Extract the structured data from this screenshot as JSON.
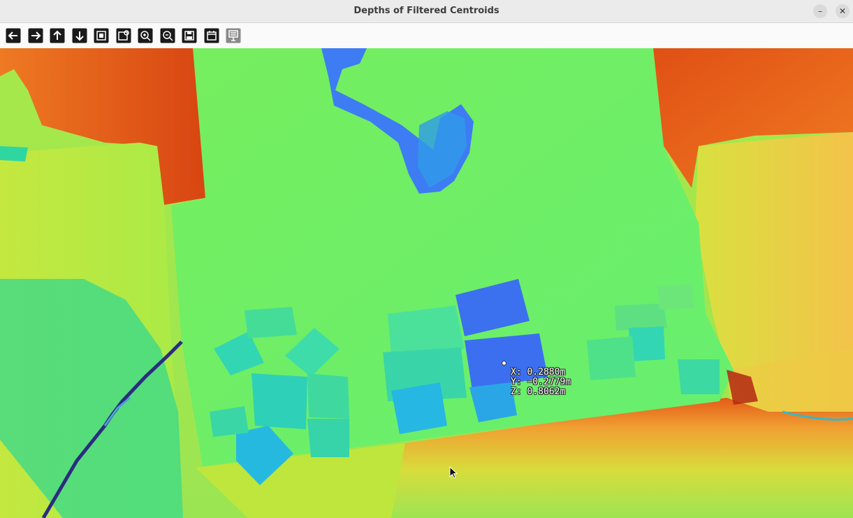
{
  "window": {
    "title": "Depths of Filtered Centroids",
    "minimize_label": "–",
    "close_label": "✕"
  },
  "toolbar": {
    "buttons": [
      {
        "name": "pan-left-button",
        "icon": "arrow-left-icon"
      },
      {
        "name": "pan-right-button",
        "icon": "arrow-right-icon"
      },
      {
        "name": "pan-up-button",
        "icon": "arrow-up-icon"
      },
      {
        "name": "pan-down-button",
        "icon": "arrow-down-icon"
      },
      {
        "name": "zoom-fit-button",
        "icon": "fit-image-icon"
      },
      {
        "name": "zoom-actual-button",
        "icon": "actual-size-icon"
      },
      {
        "name": "zoom-in-button",
        "icon": "zoom-in-icon"
      },
      {
        "name": "zoom-out-button",
        "icon": "zoom-out-icon"
      },
      {
        "name": "save-button",
        "icon": "save-icon"
      },
      {
        "name": "properties-button",
        "icon": "properties-icon"
      },
      {
        "name": "settings-button",
        "icon": "settings-icon"
      }
    ]
  },
  "readout": {
    "x": "X: 0.2880m",
    "y": "Y: −0.2779m",
    "z": "Z: 0.8062m"
  }
}
